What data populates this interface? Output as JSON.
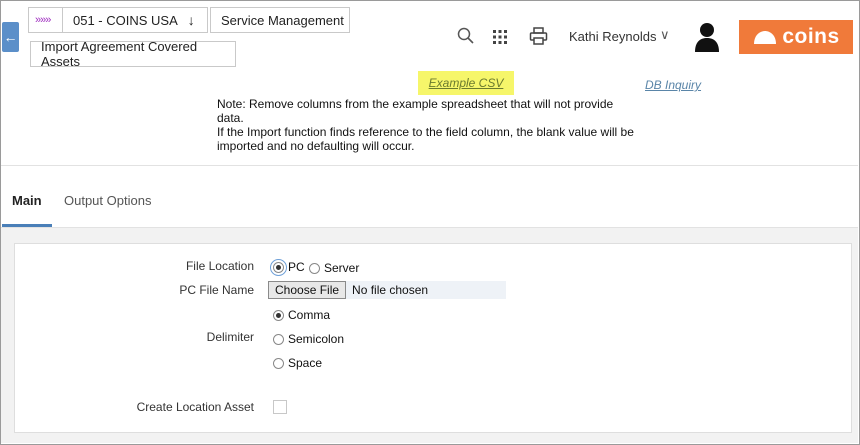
{
  "header": {
    "breadcrumbs": [
      "»»»",
      "051 - COINS USA",
      "Service Management",
      "Import Agreement Covered Assets"
    ],
    "user_name": "Kathi Reynolds",
    "logo_text": "coins",
    "accent_color": "#f07a3a"
  },
  "links": {
    "example_csv": "Example CSV",
    "db_inquiry": "DB Inquiry"
  },
  "note": {
    "line1": "Note: Remove columns from the example spreadsheet that will not provide data.",
    "line2": "If the Import function finds reference to the field column, the blank value will be imported and no defaulting will occur."
  },
  "tabs": [
    {
      "label": "Main",
      "active": true
    },
    {
      "label": "Output Options",
      "active": false
    }
  ],
  "form": {
    "file_location_label": "File Location",
    "file_location_options": [
      "PC",
      "Server"
    ],
    "file_location_selected": "PC",
    "pc_file_name_label": "PC File Name",
    "choose_file_label": "Choose File",
    "no_file_text": "No file chosen",
    "delimiter_label": "Delimiter",
    "delimiter_options": [
      "Comma",
      "Semicolon",
      "Space"
    ],
    "delimiter_selected": "Comma",
    "create_location_asset_label": "Create Location Asset",
    "create_location_asset_checked": false
  }
}
